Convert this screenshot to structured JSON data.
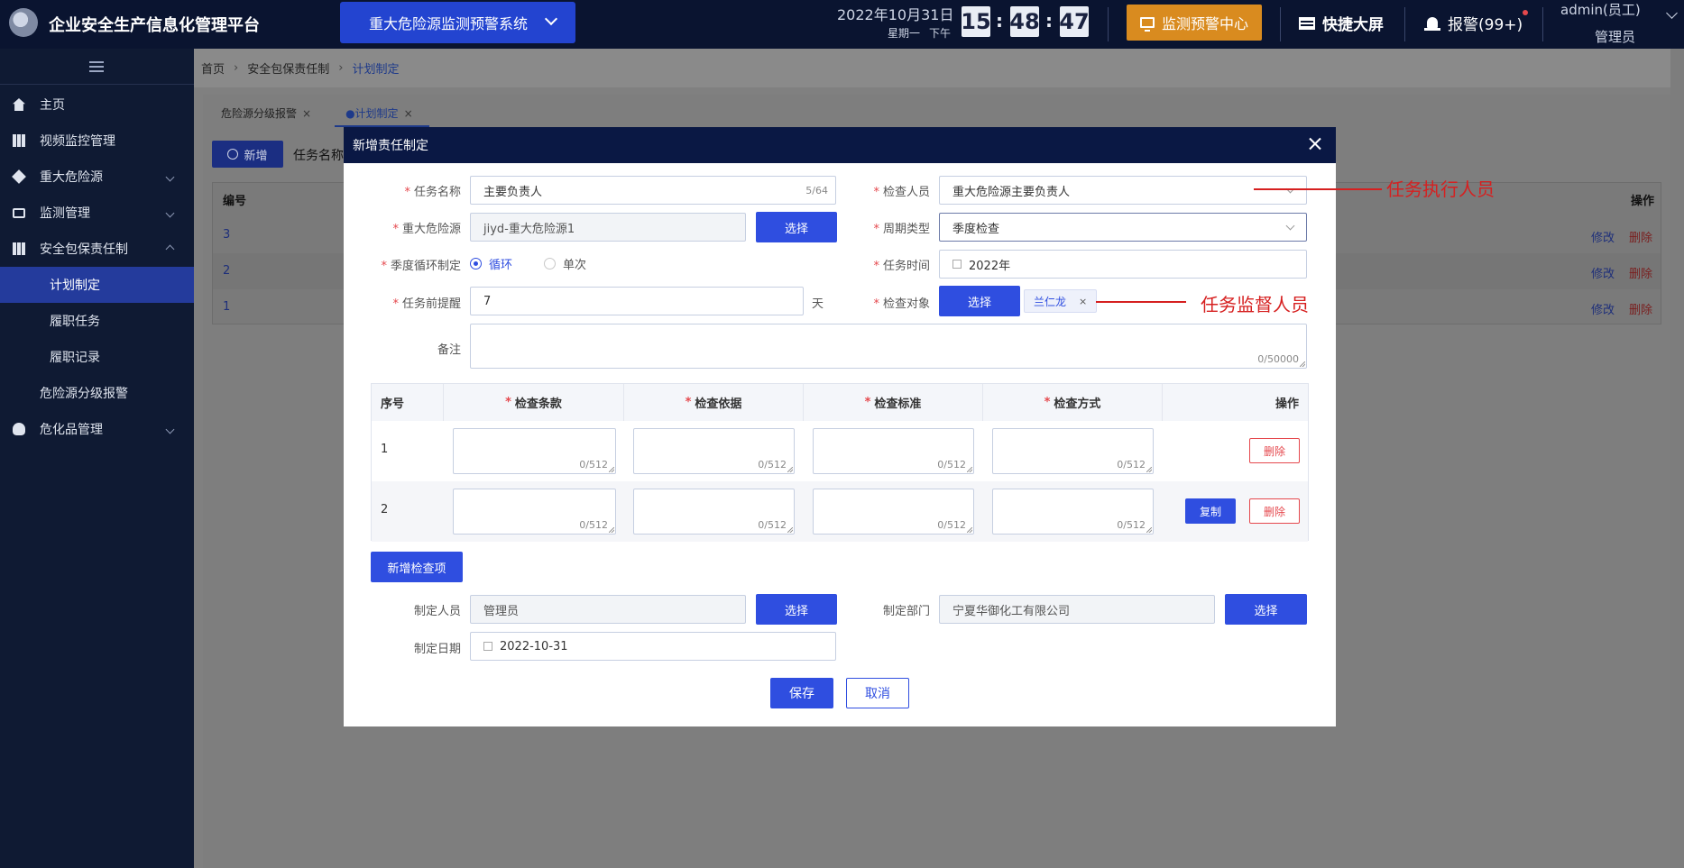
{
  "app": {
    "title": "企业安全生产信息化管理平台",
    "system_select": "重大危险源监测预警系统"
  },
  "header": {
    "date": "2022年10月31日",
    "weekday": "星期一",
    "period": "下午",
    "clock": {
      "h": "15",
      "m": "48",
      "s": "47"
    },
    "monitor_center": "监测预警中心",
    "quick_screen": "快捷大屏",
    "alarm": "报警(99+)",
    "user_name": "admin(员工)",
    "user_role": "管理员"
  },
  "sidebar": {
    "items": [
      {
        "label": "主页"
      },
      {
        "label": "视频监控管理"
      },
      {
        "label": "重大危险源"
      },
      {
        "label": "监测管理"
      },
      {
        "label": "安全包保责任制"
      },
      {
        "label": "计划制定"
      },
      {
        "label": "履职任务"
      },
      {
        "label": "履职记录"
      },
      {
        "label": "危险源分级报警"
      },
      {
        "label": "危化品管理"
      }
    ]
  },
  "breadcrumb": [
    "首页",
    "安全包保责任制",
    "计划制定"
  ],
  "tabs": [
    {
      "label": "危险源分级报警"
    },
    {
      "label": "●计划制定"
    }
  ],
  "background": {
    "add_button": "新增",
    "search_label": "任务名称",
    "col_no": "编号",
    "col_op": "操作",
    "rows": [
      {
        "no": "3"
      },
      {
        "no": "2"
      },
      {
        "no": "1"
      }
    ],
    "edit": "修改",
    "delete": "删除"
  },
  "modal": {
    "title": "新增责任制定",
    "task_name": {
      "label": "任务名称",
      "value": "主要负责人",
      "count": "5/64"
    },
    "inspector": {
      "label": "检查人员",
      "value": "重大危险源主要负责人"
    },
    "hazard": {
      "label": "重大危险源",
      "value": "jiyd-重大危险源1",
      "select": "选择"
    },
    "cycle_type": {
      "label": "周期类型",
      "value": "季度检查"
    },
    "season_cycle": {
      "label": "季度循环制定",
      "option1": "循环",
      "option2": "单次"
    },
    "task_time": {
      "label": "任务时间",
      "value": "2022年"
    },
    "reminder": {
      "label": "任务前提醒",
      "value": "7",
      "unit": "天"
    },
    "target": {
      "label": "检查对象",
      "select": "选择",
      "tag": "兰仁龙",
      "tag_close": "×"
    },
    "remark": {
      "label": "备注",
      "count": "0/50000"
    },
    "table": {
      "headers": [
        "序号",
        "检查条款",
        "检查依据",
        "检查标准",
        "检查方式",
        "操作"
      ],
      "rows": [
        {
          "idx": "1"
        },
        {
          "idx": "2"
        }
      ],
      "cell_count": "0/512",
      "copy": "复制",
      "delete": "删除"
    },
    "add_item": "新增检查项",
    "maker": {
      "label": "制定人员",
      "value": "管理员",
      "select": "选择"
    },
    "dept": {
      "label": "制定部门",
      "value": "宁夏华御化工有限公司",
      "select": "选择"
    },
    "date": {
      "label": "制定日期",
      "value": "2022-10-31"
    },
    "save": "保存",
    "cancel": "取消"
  },
  "annotations": {
    "executor": "任务执行人员",
    "supervisor": "任务监督人员"
  }
}
